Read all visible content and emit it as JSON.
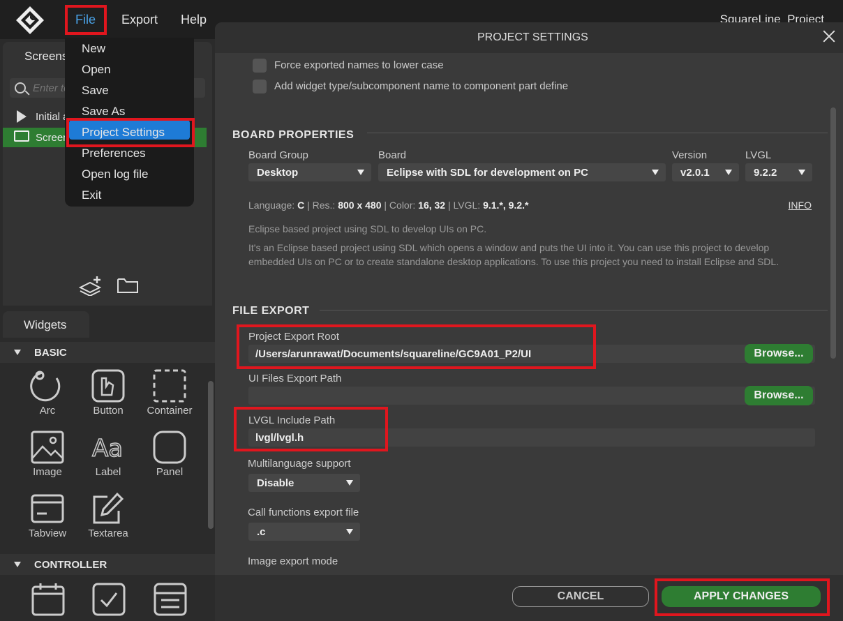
{
  "app": {
    "title": "SquareLine_Project",
    "menu": [
      "File",
      "Export",
      "Help"
    ]
  },
  "file_menu": {
    "items": [
      "New",
      "Open",
      "Save",
      "Save As",
      "Project Settings",
      "Preferences",
      "Open log file",
      "Exit"
    ],
    "active": "Project Settings"
  },
  "screens_panel": {
    "tab": "Screens",
    "search_placeholder": "Enter text",
    "tree": [
      "Initial actions",
      "Screen1"
    ]
  },
  "widgets_panel": {
    "tab": "Widgets",
    "categories": [
      {
        "name": "BASIC",
        "widgets": [
          "Arc",
          "Button",
          "Container",
          "Image",
          "Label",
          "Panel",
          "Tabview",
          "Textarea"
        ]
      },
      {
        "name": "CONTROLLER",
        "widgets": []
      }
    ]
  },
  "dialog": {
    "title": "PROJECT SETTINGS",
    "checkboxes": [
      {
        "label": "Force exported names to lower case",
        "checked": false
      },
      {
        "label": "Add widget type/subcomponent name to component part define",
        "checked": false
      }
    ],
    "board_properties": {
      "section": "BOARD PROPERTIES",
      "board_group_label": "Board Group",
      "board_group": "Desktop",
      "board_label": "Board",
      "board": "Eclipse with SDL for development on PC",
      "version_label": "Version",
      "version": "v2.0.1",
      "lvgl_label": "LVGL",
      "lvgl": "9.2.2",
      "info": {
        "language_label": "Language:",
        "language": "C",
        "res_label": "Res.:",
        "res": "800 x 480",
        "color_label": "Color:",
        "color": "16, 32",
        "lvgl_label": "LVGL:",
        "lvgl": "9.1.*, 9.2.*",
        "link": "INFO"
      },
      "short_desc": "Eclipse based project using SDL to develop UIs on PC.",
      "long_desc": "It's an Eclipse based project using SDL which opens a window and puts the UI into it. You can use this project to develop embedded UIs on PC or to create standalone desktop applications. To use this project you need to install Eclipse and SDL."
    },
    "file_export": {
      "section": "FILE EXPORT",
      "export_root_label": "Project Export Root",
      "export_root": "/Users/arunrawat/Documents/squareline/GC9A01_P2/UI",
      "ui_files_label": "UI Files Export Path",
      "ui_files": "",
      "browse": "Browse...",
      "lvgl_include_label": "LVGL Include Path",
      "lvgl_include": "lvgl/lvgl.h",
      "multilang_label": "Multilanguage support",
      "multilang": "Disable",
      "call_func_label": "Call functions export file",
      "call_func": ".c",
      "image_export_label": "Image export mode"
    },
    "cancel": "CANCEL",
    "apply": "APPLY CHANGES"
  },
  "colors": {
    "accent_blue": "#1e7bd6",
    "green": "#2e7d32",
    "highlight_red": "#e0161e"
  }
}
